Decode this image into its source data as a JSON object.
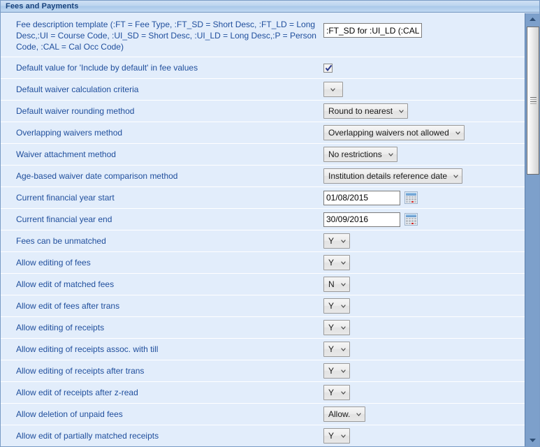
{
  "window": {
    "title": "Fees and Payments"
  },
  "colors": {
    "title_text": "#17427c",
    "label_text": "#1f4e9c",
    "row_background": "#e2edfb",
    "scroll_track": "#7da0cb",
    "calendar_marker": "#d02a2a"
  },
  "rows": [
    {
      "label": "Fee description template (:FT = Fee Type, :FT_SD = Short Desc, :FT_LD = Long Desc,:UI = Course Code, :UI_SD = Short Desc, :UI_LD = Long Desc,:P = Person Code, :CAL = Cal Occ Code)",
      "control": "text",
      "value": ":FT_SD for :UI_LD (:CAL)",
      "name": "fee-description-template"
    },
    {
      "label": "Default value for 'Include by default' in fee values",
      "control": "checkbox",
      "checked": true,
      "name": "include-by-default"
    },
    {
      "label": "Default waiver calculation criteria",
      "control": "select",
      "value": "",
      "name": "default-waiver-calculation-criteria"
    },
    {
      "label": "Default waiver rounding method",
      "control": "select",
      "value": "Round to nearest",
      "name": "default-waiver-rounding-method"
    },
    {
      "label": "Overlapping waivers method",
      "control": "select",
      "value": "Overlapping waivers not allowed",
      "name": "overlapping-waivers-method"
    },
    {
      "label": "Waiver attachment method",
      "control": "select",
      "value": "No restrictions",
      "name": "waiver-attachment-method"
    },
    {
      "label": "Age-based waiver date comparison method",
      "control": "select",
      "value": "Institution details reference date",
      "name": "age-based-waiver-date-comparison-method"
    },
    {
      "label": "Current financial year start",
      "control": "date",
      "value": "01/08/2015",
      "name": "current-financial-year-start"
    },
    {
      "label": "Current financial year end",
      "control": "date",
      "value": "30/09/2016",
      "name": "current-financial-year-end"
    },
    {
      "label": "Fees can be unmatched",
      "control": "select",
      "value": "Y",
      "name": "fees-can-be-unmatched"
    },
    {
      "label": "Allow editing of fees",
      "control": "select",
      "value": "Y",
      "name": "allow-editing-of-fees"
    },
    {
      "label": "Allow edit of matched fees",
      "control": "select",
      "value": "N",
      "name": "allow-edit-of-matched-fees"
    },
    {
      "label": "Allow edit of fees after trans",
      "control": "select",
      "value": "Y",
      "name": "allow-edit-of-fees-after-trans"
    },
    {
      "label": "Allow editing of receipts",
      "control": "select",
      "value": "Y",
      "name": "allow-editing-of-receipts"
    },
    {
      "label": "Allow editing of receipts assoc. with till",
      "control": "select",
      "value": "Y",
      "name": "allow-editing-of-receipts-assoc-with-till"
    },
    {
      "label": "Allow editing of receipts after trans",
      "control": "select",
      "value": "Y",
      "name": "allow-editing-of-receipts-after-trans"
    },
    {
      "label": "Allow edit of receipts after z-read",
      "control": "select",
      "value": "Y",
      "name": "allow-edit-of-receipts-after-z-read"
    },
    {
      "label": "Allow deletion of unpaid fees",
      "control": "select",
      "value": "Allow.",
      "name": "allow-deletion-of-unpaid-fees"
    },
    {
      "label": "Allow edit of partially matched receipts",
      "control": "select",
      "value": "Y",
      "name": "allow-edit-of-partially-matched-receipts"
    }
  ],
  "scrollbar": {
    "up_arrow": "scroll-up-arrow-icon",
    "down_arrow": "scroll-down-arrow-icon",
    "thumb": "scroll-thumb"
  },
  "icons": {
    "calendar": "calendar-picker-icon",
    "checkmark": "checkmark-icon",
    "chevron_down": "chevron-down-icon"
  }
}
